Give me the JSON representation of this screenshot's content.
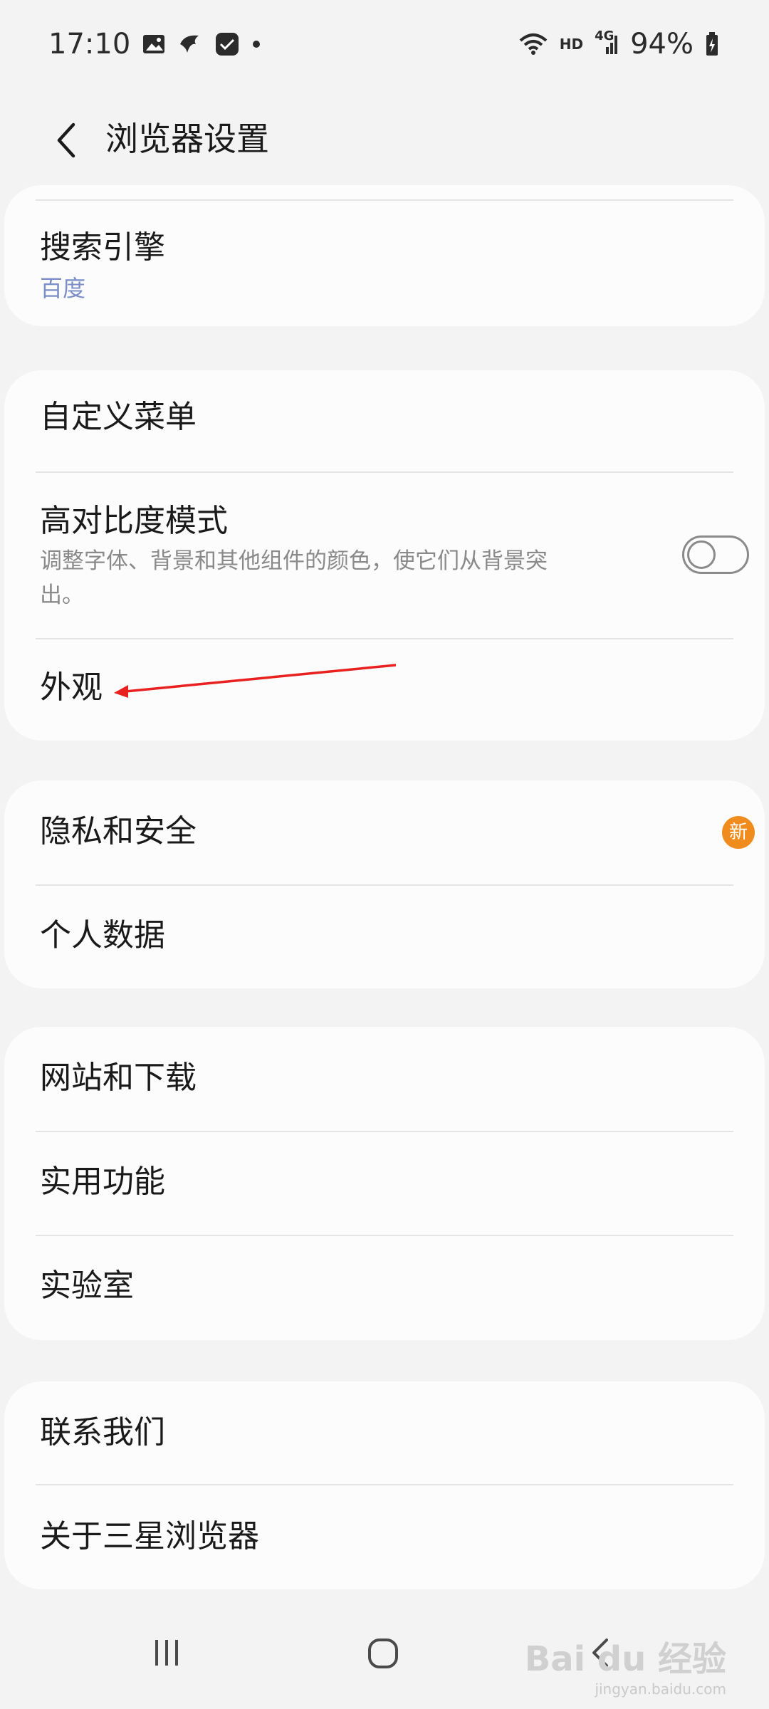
{
  "status": {
    "time": "17:10",
    "hd_label": "HD",
    "network_label": "4G",
    "battery": "94%"
  },
  "header": {
    "title": "浏览器设置"
  },
  "groups": [
    {
      "items": [
        {
          "title": "搜索引擎",
          "subtitle": "百度"
        }
      ]
    },
    {
      "items": [
        {
          "title": "自定义菜单"
        },
        {
          "title": "高对比度模式",
          "description": "调整字体、背景和其他组件的颜色，使它们从背景突出。",
          "toggle": false
        },
        {
          "title": "外观"
        }
      ]
    },
    {
      "items": [
        {
          "title": "隐私和安全",
          "badge": "新"
        },
        {
          "title": "个人数据"
        }
      ]
    },
    {
      "items": [
        {
          "title": "网站和下载"
        },
        {
          "title": "实用功能"
        },
        {
          "title": "实验室"
        }
      ]
    },
    {
      "items": [
        {
          "title": "联系我们"
        },
        {
          "title": "关于三星浏览器"
        }
      ]
    }
  ],
  "watermark": {
    "brand": "Bai du 经验",
    "url": "jingyan.baidu.com"
  },
  "colors": {
    "background": "#f3f3f3",
    "card": "#fcfcfc",
    "subtitle": "#7b8ec8",
    "badge": "#f08c1e",
    "annotation_arrow": "#e8211f"
  }
}
